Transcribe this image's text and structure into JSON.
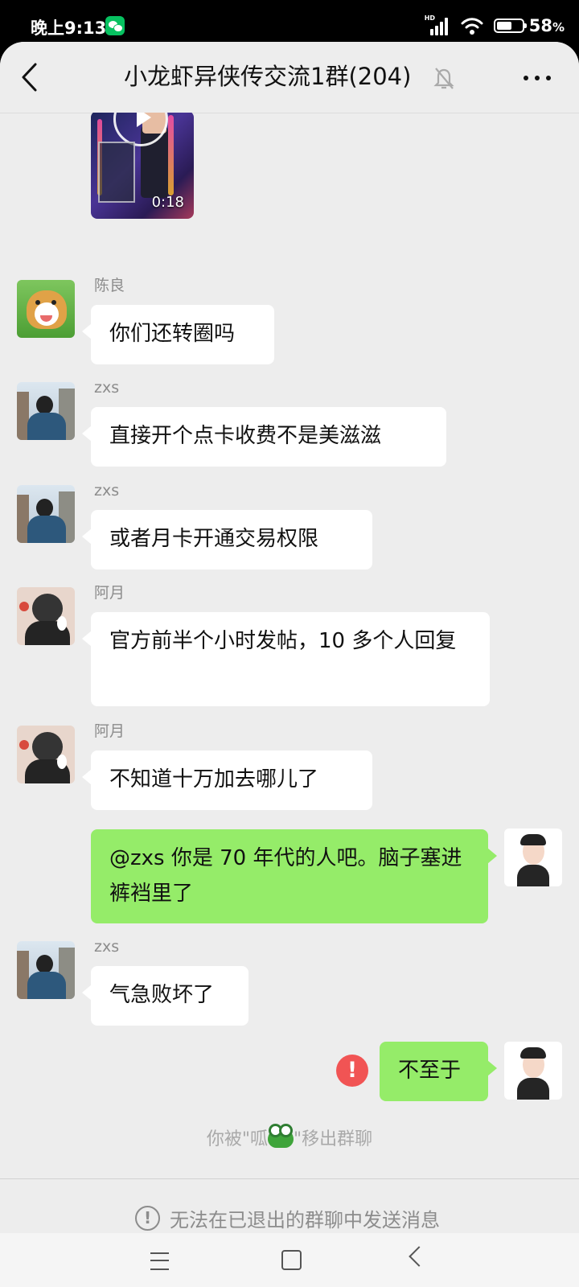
{
  "status_bar": {
    "time": "晚上9:13",
    "network": "HD",
    "battery_percent": "58",
    "battery_unit": "%"
  },
  "header": {
    "title": "小龙虾异侠传交流1群(204)",
    "back_icon": "chevron-left-icon",
    "mute_icon": "bell-off-icon",
    "more_icon": "more-horizontal-icon"
  },
  "video_message": {
    "duration": "0:18",
    "icon": "play-icon"
  },
  "messages": [
    {
      "sender": "陈良",
      "text": "你们还转圈吗",
      "direction": "incoming",
      "avatar": "shiba-dog-avatar"
    },
    {
      "sender": "zxs",
      "text": "直接开个点卡收费不是美滋滋",
      "direction": "incoming",
      "avatar": "back-view-photo-avatar"
    },
    {
      "sender": "zxs",
      "text": "或者月卡开通交易权限",
      "direction": "incoming",
      "avatar": "back-view-photo-avatar"
    },
    {
      "sender": "阿月",
      "text": "官方前半个小时发帖，10 多个人回复",
      "direction": "incoming",
      "avatar": "drawn-person-avatar"
    },
    {
      "sender": "阿月",
      "text": "不知道十万加去哪儿了",
      "direction": "incoming",
      "avatar": "drawn-person-avatar"
    },
    {
      "sender": "",
      "text": "@zxs  你是 70 年代的人吧。脑子塞进裤裆里了",
      "direction": "outgoing",
      "avatar": "cartoon-man-avatar"
    },
    {
      "sender": "zxs",
      "text": "气急败坏了",
      "direction": "incoming",
      "avatar": "back-view-photo-avatar"
    },
    {
      "sender": "",
      "text": "不至于",
      "direction": "outgoing",
      "avatar": "cartoon-man-avatar",
      "failed": true
    }
  ],
  "failed_icon": "!",
  "system_notice": {
    "prefix": "你被\"呱",
    "suffix": "\"移出群聊",
    "icon": "frog-emoji"
  },
  "footer": {
    "text": "无法在已退出的群聊中发送消息",
    "icon": "!",
    "icon_name": "info-circle-icon"
  },
  "navigation": {
    "menu_icon": "menu-icon",
    "home_icon": "home-square-icon",
    "back_icon": "back-triangle-icon"
  },
  "colors": {
    "chat_background": "#ededed",
    "incoming_bubble": "#ffffff",
    "outgoing_bubble": "#95ec69",
    "error": "#f15454"
  }
}
